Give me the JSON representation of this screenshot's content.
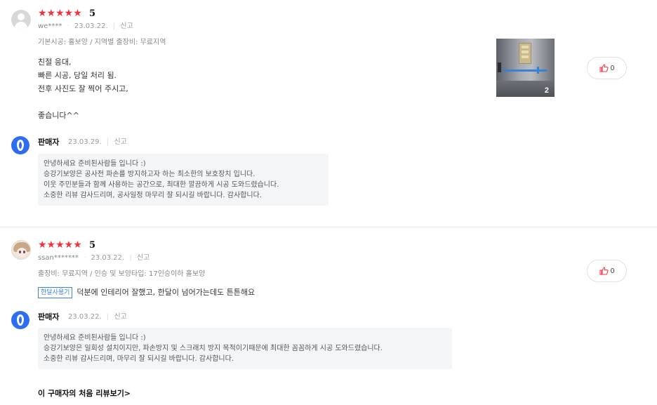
{
  "reviews": [
    {
      "stars": "★★★★★",
      "score": "5",
      "user": "we****",
      "date": "23.03.22.",
      "report": "신고",
      "option": "기본시공: 홀보양 / 지역별 출장비: 무료지역",
      "content": [
        "친절 응대,",
        "빠른 시공, 당일 처리 됨.",
        "전후 사진도 잘 찍어 주시고,",
        "",
        "좋습니다^^"
      ],
      "photo_count": "2",
      "likes": "0",
      "seller": {
        "name": "판매자",
        "date": "23.03.29.",
        "report": "신고",
        "reply": [
          "안녕하세요 준비된사람들 입니다 :)",
          "승강기보양은 공사전 파손를 방지하고자 하는 최소한의 보호장치 입니다.",
          "이웃 주민분들과 함께 사용하는 공간으로, 최대한 깔끔하게 시공 도와드렸습니다.",
          "소중한 리뷰 감사드리며, 공사일정 마무리 잘 되시길 바랍니다. 감사합니다."
        ]
      }
    },
    {
      "stars": "★★★★★",
      "score": "5",
      "user": "ssan*******",
      "date": "23.03.22.",
      "report": "신고",
      "option": "출장비: 무료지역 / 인승 및 보양타입: 17인승이하 홀보양",
      "tag": "한달사용기",
      "content": [
        "덕분에 인테리어 잘했고, 한달이 넘어가는데도 튼튼해요"
      ],
      "likes": "0",
      "seller": {
        "name": "판매자",
        "date": "23.03.22.",
        "report": "신고",
        "reply": [
          "안녕하세요 준비된사람들 입니다 :)",
          "승강기보양은 일회성 설치이지만, 파손방지 및 스크래치 방지 목적이기때문에 최대한 꼼꼼하게 시공 도와드렸습니다.",
          "소중한 리뷰 감사드리며, 마무리 잘 되시길 바랍니다. 감사합니다."
        ]
      }
    }
  ],
  "first_review_link": "이 구매자의 처음 리뷰보기>",
  "icons": {
    "like": "thumbs-up-icon",
    "seller": "seller-logo-icon",
    "avatar": "user-avatar-icon"
  },
  "colors": {
    "star": "#f5323c",
    "like_icon": "#f5323c",
    "tag": "#3b83e0",
    "seller_logo": "#2f6df0"
  }
}
